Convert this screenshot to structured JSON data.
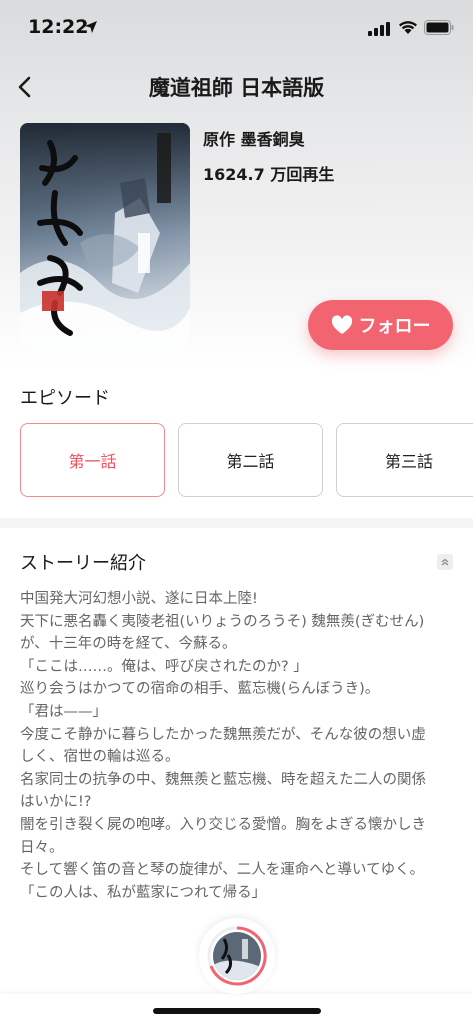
{
  "status_bar": {
    "time": "12:22"
  },
  "header": {
    "title": "魔道祖師 日本語版"
  },
  "info": {
    "author": "原作 墨香銅臭",
    "plays": "1624.7 万回再生",
    "follow_label": "フォロー",
    "accent_color": "#f26570"
  },
  "episodes": {
    "title": "エピソード",
    "items": [
      {
        "label": "第一話",
        "selected": true
      },
      {
        "label": "第二話",
        "selected": false
      },
      {
        "label": "第三話",
        "selected": false
      }
    ]
  },
  "story": {
    "title": "ストーリー紹介",
    "lines": [
      "中国発大河幻想小説、遂に日本上陸!",
      "天下に悪名轟く夷陵老祖(いりょうのろうそ) 魏無羨(ぎむせん)",
      "が、十三年の時を経て、今蘇る。",
      "「ここは……。俺は、呼び戻されたのか? 」",
      "巡り会うはかつての宿命の相手、藍忘機(らんぼうき)。",
      "「君は——」",
      "今度こそ静かに暮らしたかった魏無羨だが、そんな彼の想い虚",
      "しく、宿世の輪は巡る。",
      "名家同士の抗争の中、魏無羨と藍忘機、時を超えた二人の関係",
      "はいかに!?",
      "闇を引き裂く屍の咆哮。入り交じる愛憎。胸をよぎる懐かしき",
      "日々。",
      "そして響く笛の音と琴の旋律が、二人を運命へと導いてゆく。",
      "「この人は、私が藍家につれて帰る」"
    ]
  }
}
